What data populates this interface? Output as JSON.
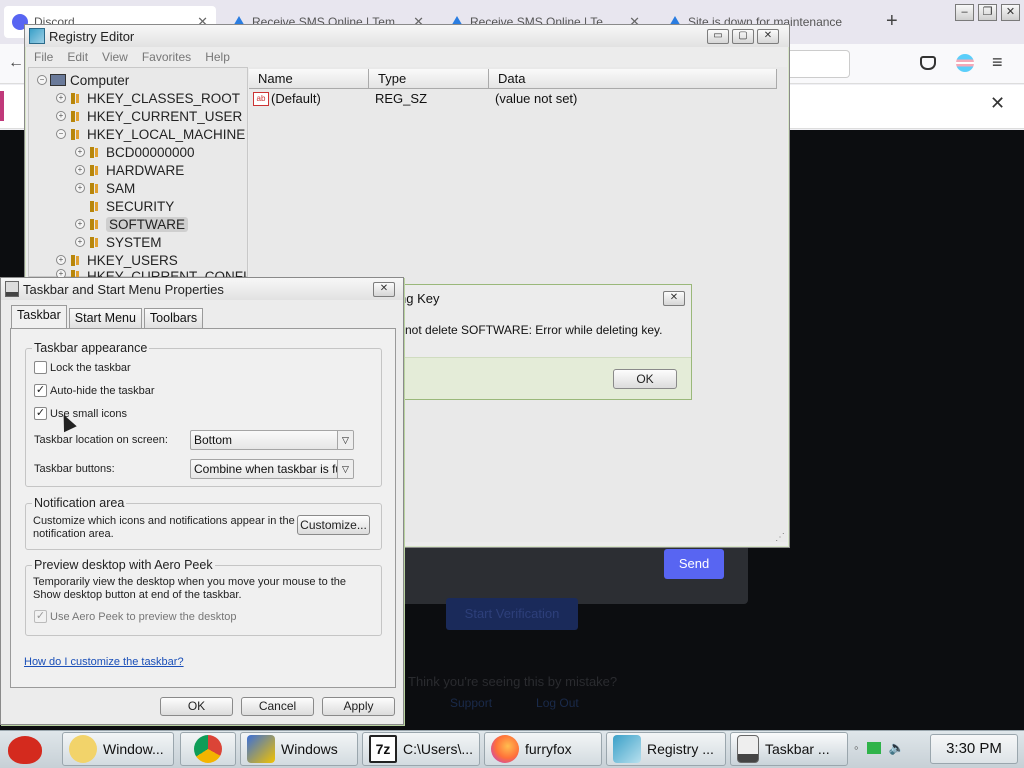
{
  "browser": {
    "tabs": [
      {
        "label": "Discord",
        "icon": "discord-icon"
      },
      {
        "label": "Receive SMS Online | Tempo",
        "icon": "blue-triangle-icon"
      },
      {
        "label": "Receive SMS Online | Tempo",
        "icon": "blue-triangle-icon"
      },
      {
        "label": "Site is down for maintenance",
        "icon": "blue-triangle-icon"
      }
    ],
    "new_tab": "+",
    "win_min": "–",
    "win_max": "❐",
    "win_close": "✕",
    "infobar_close": "✕",
    "page": {
      "send_label": "Send",
      "verify_label": "Start Verification",
      "mistake_text": "Think you're seeing this by mistake?",
      "link_a": "Support",
      "link_b": "Log Out"
    }
  },
  "regedit": {
    "title": "Registry Editor",
    "menu": [
      "File",
      "Edit",
      "View",
      "Favorites",
      "Help"
    ],
    "tree": {
      "root": "Computer",
      "items": [
        {
          "label": "HKEY_CLASSES_ROOT",
          "level": 1
        },
        {
          "label": "HKEY_CURRENT_USER",
          "level": 1
        },
        {
          "label": "HKEY_LOCAL_MACHINE",
          "level": 1
        },
        {
          "label": "BCD00000000",
          "level": 2
        },
        {
          "label": "HARDWARE",
          "level": 2
        },
        {
          "label": "SAM",
          "level": 2
        },
        {
          "label": "SECURITY",
          "level": 2
        },
        {
          "label": "SOFTWARE",
          "level": 2,
          "selected": true
        },
        {
          "label": "SYSTEM",
          "level": 2
        },
        {
          "label": "HKEY_USERS",
          "level": 1
        },
        {
          "label": "HKEY_CURRENT_CONFI",
          "level": 1
        }
      ]
    },
    "columns": [
      "Name",
      "Type",
      "Data"
    ],
    "rows": [
      {
        "name": "(Default)",
        "type": "REG_SZ",
        "data": "(value not set)"
      }
    ]
  },
  "error_dialog": {
    "title": "ng Key",
    "message": "not delete SOFTWARE:  Error while deleting key.",
    "ok": "OK"
  },
  "taskbar_props": {
    "title": "Taskbar and Start Menu Properties",
    "tabs": [
      "Taskbar",
      "Start Menu",
      "Toolbars"
    ],
    "appearance": {
      "legend": "Taskbar appearance",
      "lock": {
        "label": "Lock the taskbar",
        "checked": false
      },
      "autohide": {
        "label": "Auto-hide the taskbar",
        "checked": true
      },
      "small_icons": {
        "label": "Use small icons",
        "checked": true
      },
      "location_label": "Taskbar location on screen:",
      "location_value": "Bottom",
      "buttons_label": "Taskbar buttons:",
      "buttons_value": "Combine when taskbar is full"
    },
    "notification": {
      "legend": "Notification area",
      "text": "Customize which icons and notifications appear in the notification area.",
      "customize": "Customize..."
    },
    "peek": {
      "legend": "Preview desktop with Aero Peek",
      "text": "Temporarily view the desktop when you move your mouse to the Show desktop button at end of the taskbar.",
      "use_label": "Use Aero Peek to preview the desktop"
    },
    "help_link": "How do I customize the taskbar?",
    "ok": "OK",
    "cancel": "Cancel",
    "apply": "Apply",
    "check_mark": "✓"
  },
  "taskbar": {
    "items": [
      {
        "label": "Window...",
        "icon": "folder-people-icon",
        "color": "#f2d36a"
      },
      {
        "label": "",
        "icon": "chrome-icon",
        "color": "#db4437"
      },
      {
        "label": "Windows",
        "icon": "shield-check-icon",
        "color": "#3a6fd8"
      },
      {
        "label": "C:\\Users\\...",
        "icon": "7zip-icon",
        "color": "#222222"
      },
      {
        "label": "furryfox",
        "icon": "firefox-icon",
        "color": "#ff7139"
      },
      {
        "label": "Registry ...",
        "icon": "registry-cubes-icon",
        "color": "#3aa0c8"
      },
      {
        "label": "Taskbar ...",
        "icon": "taskbar-props-icon",
        "color": "#888888"
      }
    ],
    "clock": "3:30 PM"
  }
}
